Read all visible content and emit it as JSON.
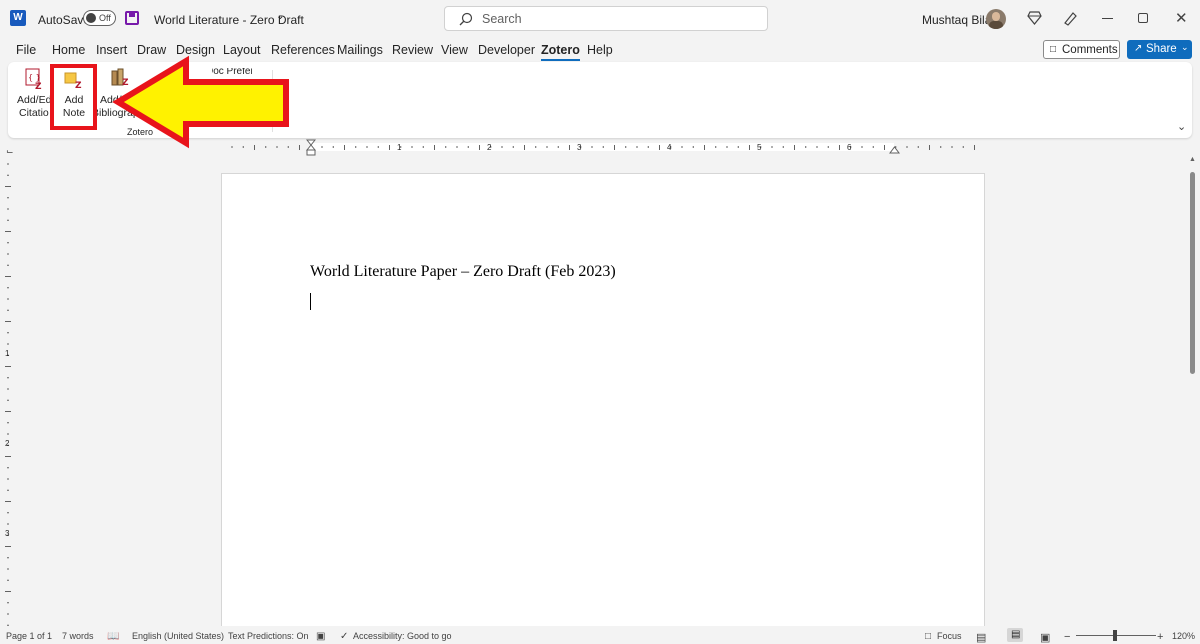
{
  "titlebar": {
    "autosave_label": "AutoSave",
    "autosave_state": "Off",
    "doc_title": "World Literature - Zero Draft",
    "search_placeholder": "Search",
    "user_name": "Mushtaq Bilal"
  },
  "menu": {
    "tabs": [
      "File",
      "Home",
      "Insert",
      "Draw",
      "Design",
      "Layout",
      "References",
      "Mailings",
      "Review",
      "View",
      "Developer",
      "Zotero",
      "Help"
    ],
    "active_tab": "Zotero",
    "comments_label": "Comments",
    "share_label": "Share"
  },
  "ribbon": {
    "buttons": [
      {
        "line1": "Add/Edit",
        "line2": "Citation"
      },
      {
        "line1": "Add",
        "line2": "Note"
      },
      {
        "line1": "Add/Edit",
        "line2": "Bibliography"
      }
    ],
    "group_label": "Zotero",
    "partial_label": "Doc Preferences"
  },
  "ruler": {
    "h_numbers": [
      "1",
      "2",
      "3",
      "4",
      "5",
      "6"
    ],
    "v_numbers": [
      "1",
      "2",
      "3"
    ]
  },
  "document": {
    "title_line": "World Literature Paper – Zero Draft (Feb 2023)"
  },
  "statusbar": {
    "page": "Page 1 of 1",
    "words": "7 words",
    "language": "English (United States)",
    "text_predictions": "Text Predictions: On",
    "accessibility": "Accessibility: Good to go",
    "focus": "Focus",
    "zoom": "120%"
  },
  "colors": {
    "accent": "#0f6cbd",
    "highlight_red": "#e8141b",
    "arrow_yellow": "#fff200"
  }
}
